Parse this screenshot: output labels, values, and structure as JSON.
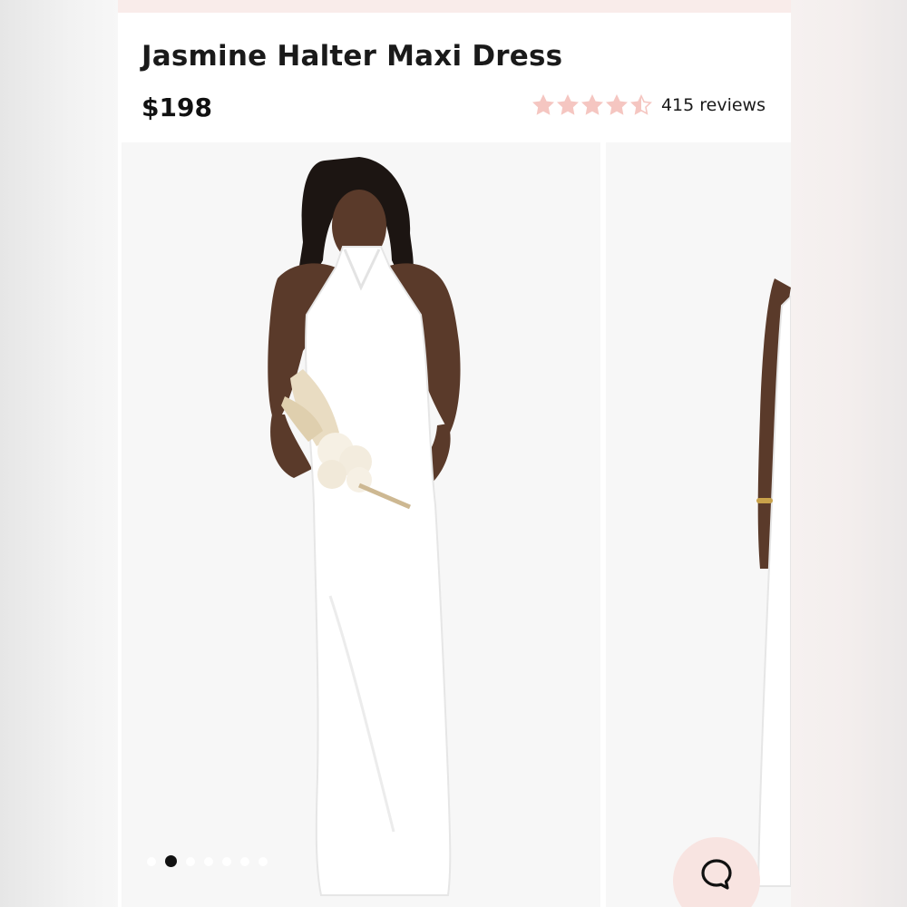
{
  "product": {
    "title": "Jasmine Halter Maxi Dress",
    "price": "$198",
    "rating": 4.5,
    "rating_max": 5,
    "reviews_label": "415 reviews"
  },
  "gallery": {
    "image_count": 7,
    "active_index": 1
  },
  "icons": {
    "star": "star-icon",
    "chat": "chat-icon"
  },
  "colors": {
    "star": "#f5c6c1",
    "accent_bg": "#f8e4e1",
    "text": "#1a1a1a"
  }
}
